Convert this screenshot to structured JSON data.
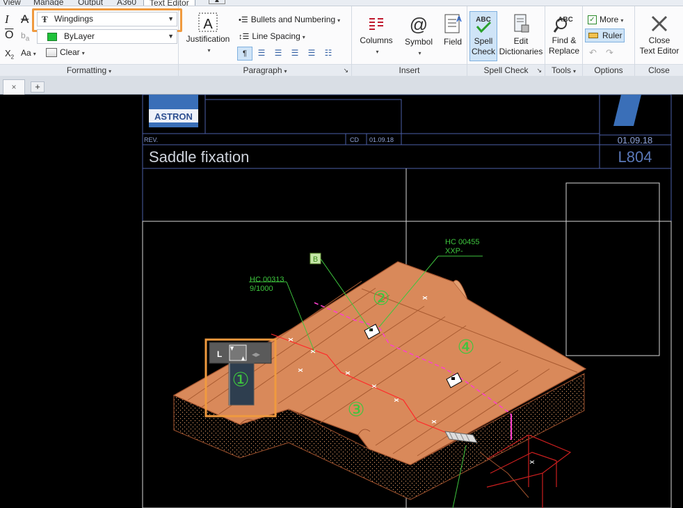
{
  "menubar": {
    "tabs": [
      "View",
      "Manage",
      "Output",
      "A360",
      "Text Editor"
    ],
    "active_tab": "Text Editor"
  },
  "formatting": {
    "title": "Formatting",
    "font_value": "Wingdings",
    "color_value": "ByLayer",
    "clear_label": "Clear",
    "case_label": "Aa"
  },
  "paragraph": {
    "title": "Paragraph",
    "justification_label": "Justification",
    "bullets_label": "Bullets and Numbering",
    "line_spacing_label": "Line Spacing"
  },
  "insert": {
    "title": "Insert",
    "columns_label": "Columns",
    "symbol_label": "Symbol",
    "field_label": "Field"
  },
  "spell_check": {
    "title": "Spell Check",
    "spell_label_1": "Spell",
    "spell_label_2": "Check",
    "edit_label_1": "Edit",
    "edit_label_2": "Dictionaries"
  },
  "tools": {
    "title": "Tools",
    "find_label_1": "Find &",
    "find_label_2": "Replace"
  },
  "options": {
    "title": "Options",
    "more_label": "More",
    "ruler_label": "Ruler"
  },
  "close": {
    "title": "Close",
    "label_1": "Close",
    "label_2": "Text Editor"
  },
  "drawing": {
    "logo_text": "ASTRON",
    "rev_label": "REV.",
    "cd_label": "CD",
    "date_small": "01.09.18",
    "date_right": "01.09.18",
    "title": "Saddle fixation",
    "sheet_number": "L804",
    "callout_b": "B",
    "hc1_line1": "HC 00455",
    "hc1_line2": "XXP-",
    "hc2_line1": "HC 00313",
    "hc2_line2": "9/1000",
    "num_1": "①",
    "num_2": "②",
    "num_3": "③",
    "num_4": "④"
  },
  "colors": {
    "roof": "#d9895a",
    "roof_edge": "#a0522d",
    "title_blue": "#5a78b8",
    "label_green": "#3ec53e",
    "highlight": "#f09a3e"
  }
}
